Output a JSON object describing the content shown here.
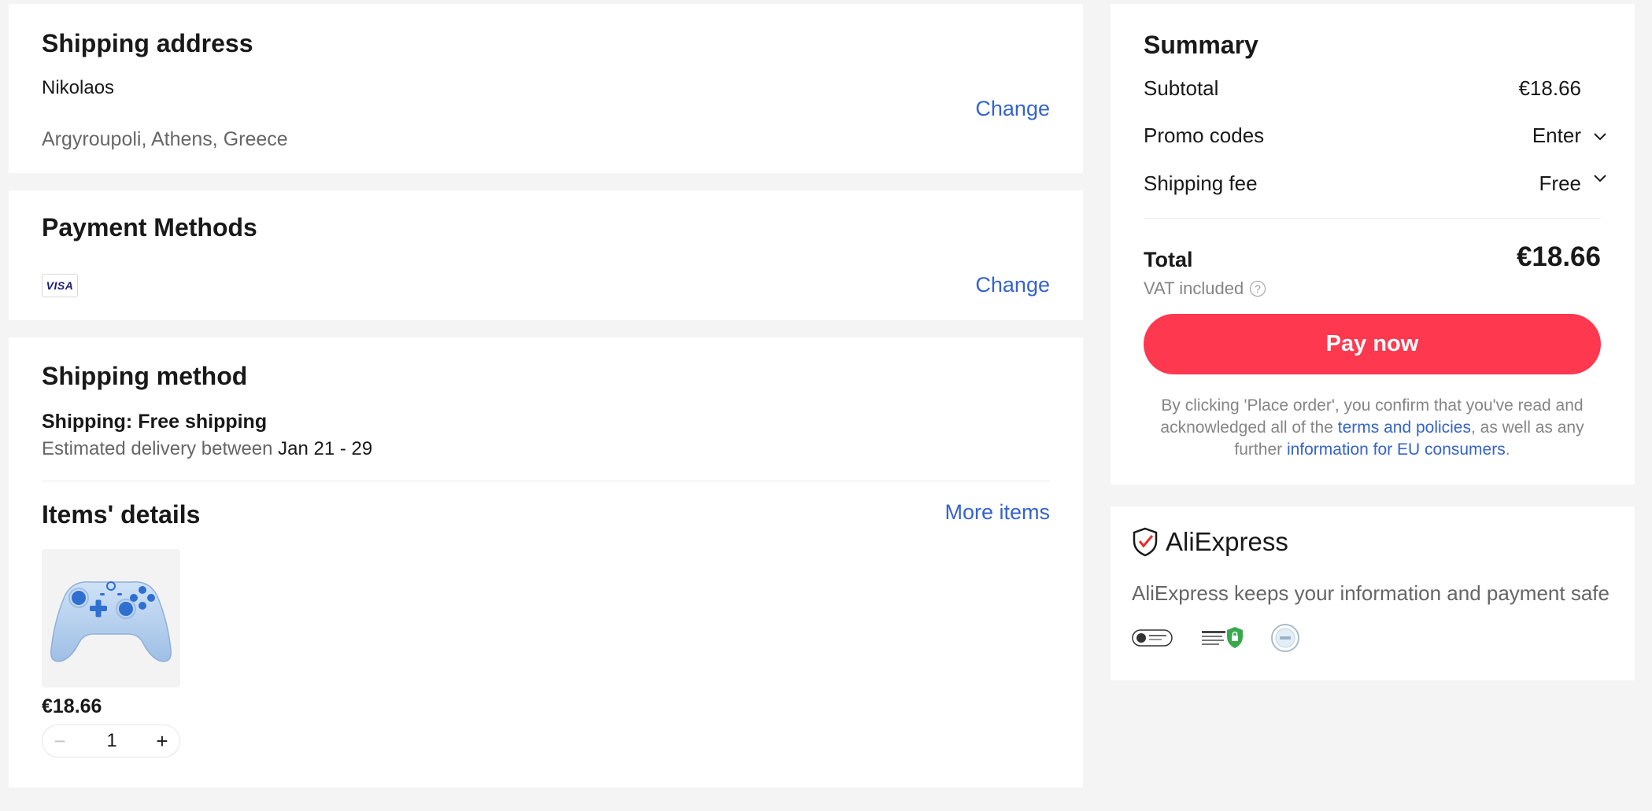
{
  "shipping_address": {
    "title": "Shipping address",
    "name": "Nikolaos",
    "location": "Argyroupoli, Athens, Greece",
    "change_label": "Change"
  },
  "payment": {
    "title": "Payment Methods",
    "card_brand": "VISA",
    "change_label": "Change"
  },
  "shipping_method": {
    "title": "Shipping method",
    "shipping_label": "Shipping: Free shipping",
    "delivery_prefix": "Estimated delivery between ",
    "delivery_dates": "Jan 21 - 29"
  },
  "items": {
    "title": "Items' details",
    "more_label": "More items",
    "list": [
      {
        "price": "€18.66",
        "quantity": "1",
        "image_icon": "gamepad-icon"
      }
    ]
  },
  "summary": {
    "title": "Summary",
    "subtotal_label": "Subtotal",
    "subtotal_value": "€18.66",
    "promo_label": "Promo codes",
    "promo_value": "Enter",
    "shipping_label": "Shipping fee",
    "shipping_value": "Free",
    "total_label": "Total",
    "total_value": "€18.66",
    "vat_label": "VAT included",
    "pay_label": "Pay now",
    "legal_1": "By clicking 'Place order', you confirm that you've read and acknowledged all of the ",
    "legal_link_1": "terms and policies",
    "legal_2": ", as well as any further ",
    "legal_link_2": "information for EU consumers",
    "legal_3": "."
  },
  "trust": {
    "brand": "AliExpress",
    "message": "AliExpress keeps your information and payment safe"
  },
  "colors": {
    "accent_red": "#fd384f",
    "link_blue": "#3563c9",
    "text": "#191919",
    "muted": "#666666",
    "background": "#f4f4f4"
  }
}
